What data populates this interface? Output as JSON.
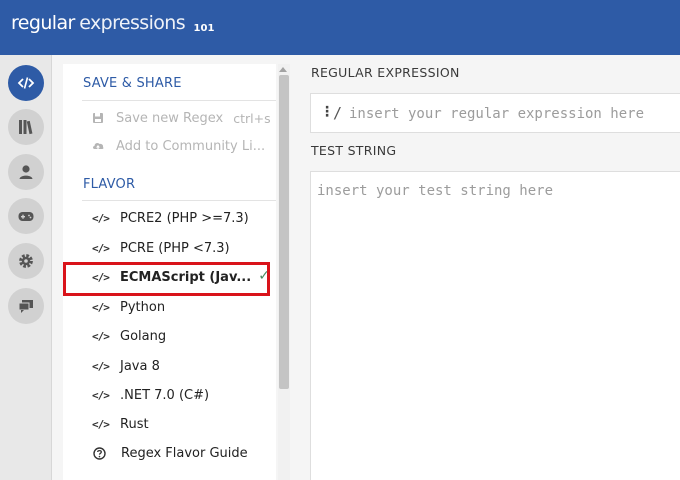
{
  "header": {
    "logo_word1": "regular",
    "logo_word2": "expressions",
    "logo_version": "101"
  },
  "sidebar": {
    "icons": [
      "code-icon",
      "library-icon",
      "account-icon",
      "quiz-icon",
      "settings-icon",
      "chat-icon"
    ]
  },
  "menu": {
    "save_share_title": "SAVE & SHARE",
    "save_label": "Save new Regex",
    "save_shortcut": "ctrl+s",
    "community_label": "Add to Community Li...",
    "flavor_title": "FLAVOR",
    "code_glyph": "</>",
    "flavors": [
      {
        "label": "PCRE2 (PHP >=7.3)"
      },
      {
        "label": "PCRE (PHP <7.3)"
      },
      {
        "label": "ECMAScript (Jav..."
      },
      {
        "label": "Python"
      },
      {
        "label": "Golang"
      },
      {
        "label": "Java 8"
      },
      {
        "label": ".NET 7.0 (C#)"
      },
      {
        "label": "Rust"
      }
    ],
    "selected_index": 2,
    "check_mark": "✓",
    "guide_label": "Regex Flavor Guide"
  },
  "main": {
    "regex_label": "REGULAR EXPRESSION",
    "regex_dots": "⋮",
    "regex_delimiter": "/",
    "regex_placeholder": "insert your regular expression here",
    "test_label": "TEST STRING",
    "test_placeholder": "insert your test string here"
  },
  "colors": {
    "brand": "#2e5ba6",
    "highlight": "#d9131a",
    "check": "#4a8a60"
  }
}
